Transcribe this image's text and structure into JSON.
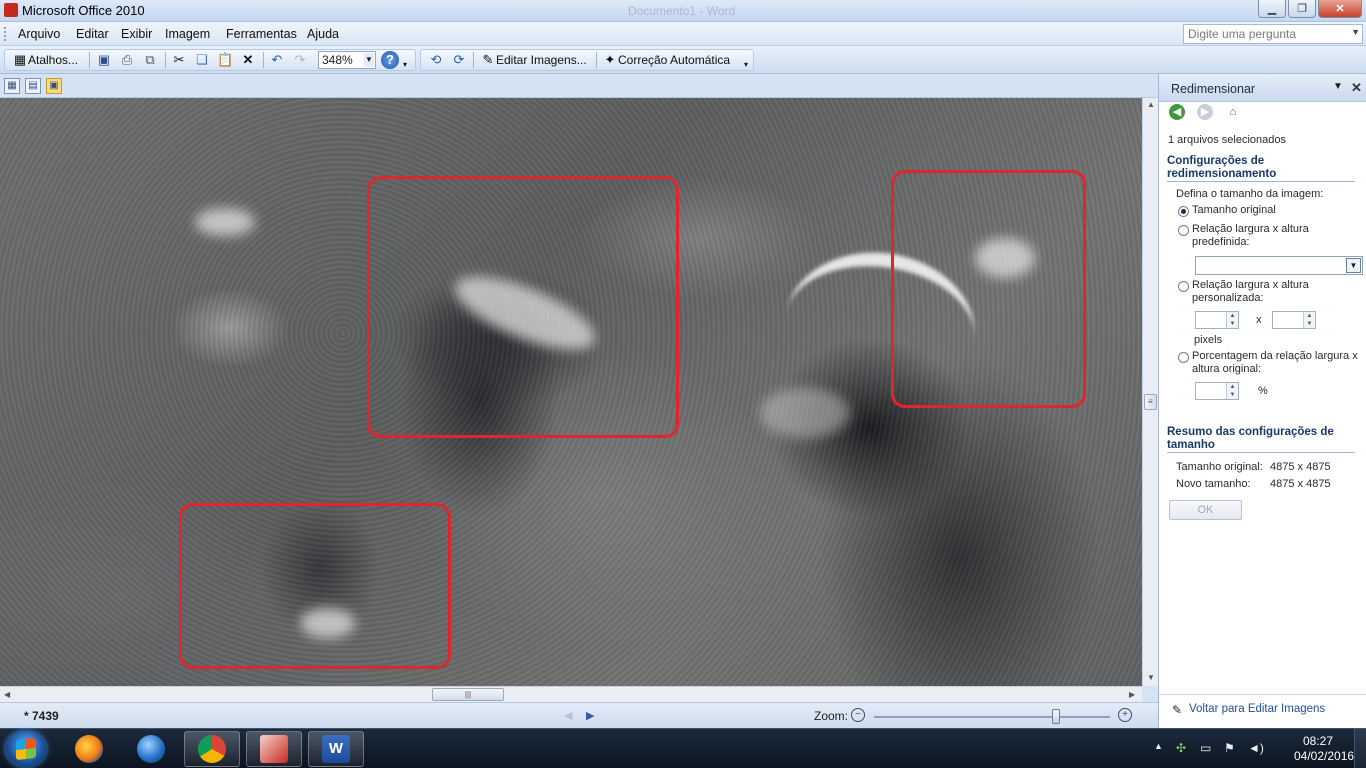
{
  "window": {
    "title": "Microsoft Office 2010",
    "ghost_title": "Documento1 - Word",
    "minimize": "▁",
    "maximize": "❐",
    "close": "✕"
  },
  "menu": {
    "items": [
      "Arquivo",
      "Editar",
      "Exibir",
      "Imagem",
      "Ferramentas",
      "Ajuda"
    ],
    "ask_placeholder": "Digite uma pergunta"
  },
  "toolbar": {
    "shortcuts_label": "Atalhos...",
    "zoom_value": "348%",
    "edit_images_label": "Editar Imagens...",
    "autocorrect_label": "Correção Automática"
  },
  "status": {
    "item_number": "* 7439",
    "zoom_label": "Zoom:",
    "zoom_level_fraction": 0.78
  },
  "taskpane": {
    "title": "Redimensionar",
    "files_selected": "1 arquivos selecionados",
    "settings_heading": "Configurações de redimensionamento",
    "define_size": "Defina o tamanho da imagem:",
    "opt_original": "Tamanho original",
    "opt_predefined": "Relação largura x altura predefinida:",
    "opt_custom": "Relação largura x altura personalizada:",
    "x_sep": "x",
    "pixels": "pixels",
    "opt_percentage": "Porcentagem da relação largura x altura original:",
    "percent": "%",
    "summary_heading": "Resumo das configurações de tamanho",
    "original_size_label": "Tamanho original:",
    "original_size_value": "4875 x 4875",
    "new_size_label": "Novo tamanho:",
    "new_size_value": "4875 x 4875",
    "ok_button": "OK",
    "back_link": "Voltar para Editar Imagens"
  },
  "taskbar": {
    "time": "08:27",
    "date": "04/02/2016"
  },
  "colors": {
    "highlight_red": "#e0262a",
    "link_blue": "#1f4f9c",
    "heading_blue": "#1a3868"
  }
}
